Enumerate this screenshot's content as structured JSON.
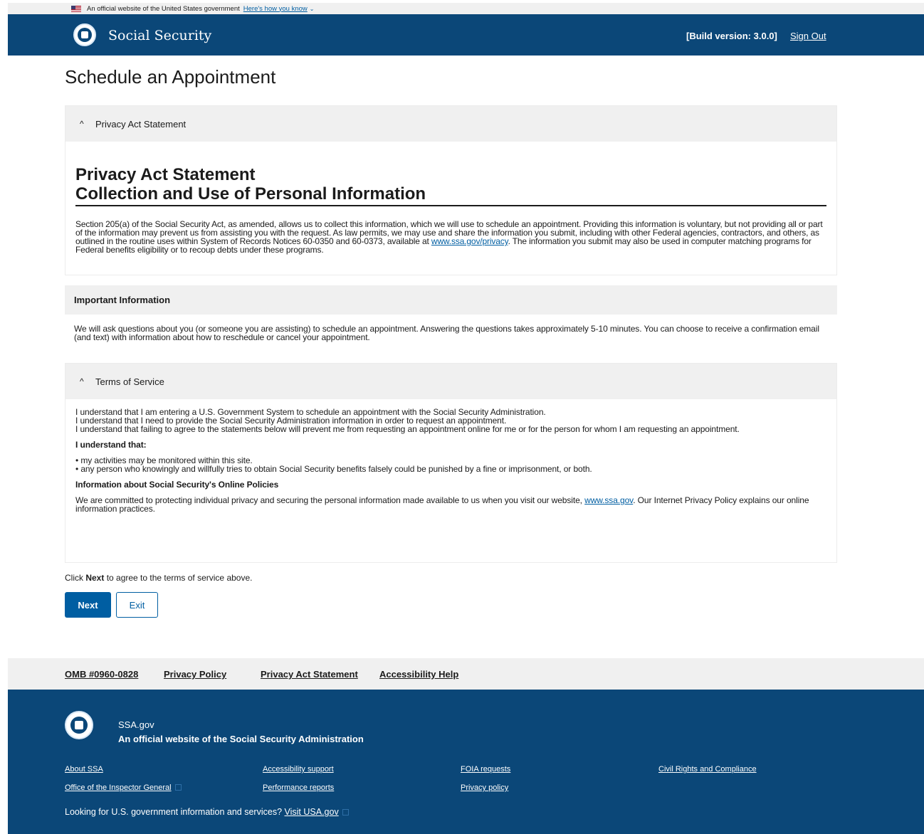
{
  "gov_banner": {
    "text": "An official website of the United States government",
    "link": "Here's how you know"
  },
  "header": {
    "site_name": "Social Security",
    "build_version": "[Build version: 3.0.0]",
    "sign_out": "Sign Out"
  },
  "page_title": "Schedule an Appointment",
  "privacy_panel": {
    "toggle_label": "Privacy Act Statement",
    "heading_line1": "Privacy Act Statement",
    "heading_line2": "Collection and Use of Personal Information",
    "text_before_link": "Section 205(a) of the Social Security Act, as amended, allows us to collect this information, which we will use to schedule an appointment. Providing this information is voluntary, but not providing all or part of the information may prevent us from assisting you with the request. As law permits, we may use and share the information you submit, including with other Federal agencies, contractors, and others, as outlined in the routine uses within System of Records Notices 60-0350 and 60-0373, available at ",
    "link": "www.ssa.gov/privacy",
    "text_after_link": ". The information you submit may also be used in computer matching programs for Federal benefits eligibility or to recoup debts under these programs."
  },
  "important_panel": {
    "heading": "Important Information",
    "text": "We will ask questions about you (or someone you are assisting) to schedule an appointment. Answering the questions takes approximately 5-10 minutes. You can choose to receive a confirmation email (and text) with information about how to reschedule or cancel your appointment."
  },
  "terms_panel": {
    "toggle_label": "Terms of Service",
    "line1": "I understand that I am entering a U.S. Government System to schedule an appointment with the Social Security Administration.",
    "line2": "I understand that I need to provide the Social Security Administration information in order to request an appointment.",
    "line3": "I understand that failing to agree to the statements below will prevent me from requesting an appointment online for me or for the person for whom I am requesting an appointment.",
    "understand_heading": "I understand that:",
    "bullet1": "• my activities may be monitored within this site.",
    "bullet2": "• any person who knowingly and willfully tries to obtain Social Security benefits falsely could be punished by a fine or imprisonment, or both.",
    "policies_heading": "Information about Social Security's Online Policies",
    "policies_before_link": "We are committed to protecting individual privacy and securing the personal information made available to us when you visit our website, ",
    "policies_link": "www.ssa.gov",
    "policies_after_link": ". Our Internet Privacy Policy explains our online information practices."
  },
  "agree": {
    "before": "Click ",
    "bold": "Next",
    "after": " to agree to the terms of service above."
  },
  "buttons": {
    "next": "Next",
    "exit": "Exit"
  },
  "footer_links": {
    "omb": "OMB #0960-0828",
    "privacy_policy": "Privacy Policy",
    "privacy_act": "Privacy Act Statement",
    "accessibility": "Accessibility Help"
  },
  "footer": {
    "site": "SSA.gov",
    "official": "An official website of the Social Security Administration",
    "about": "About SSA",
    "oig": "Office of the Inspector General",
    "accessibility_support": "Accessibility support",
    "performance": "Performance reports",
    "foia": "FOIA requests",
    "privacy_policy": "Privacy policy",
    "civil_rights": "Civil Rights and Compliance",
    "looking_text": "Looking for U.S. government information and services? ",
    "visit_usa": "Visit USA.gov"
  }
}
